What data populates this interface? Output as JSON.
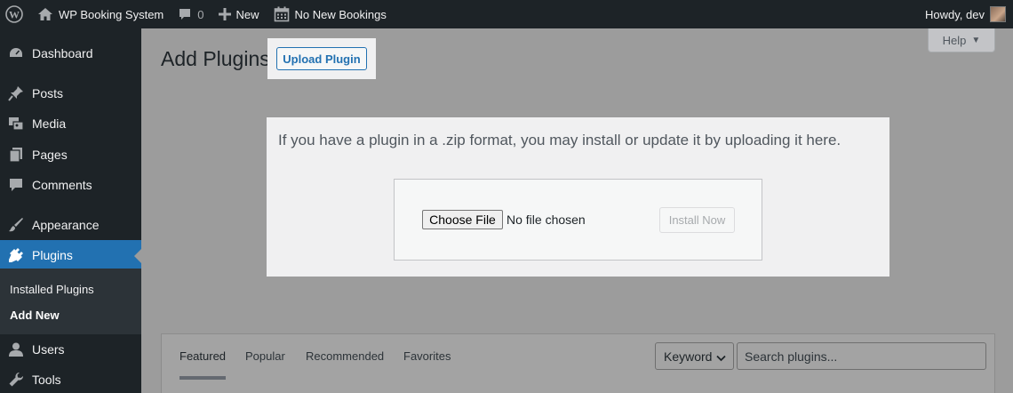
{
  "adminbar": {
    "site_name": "WP Booking System",
    "comments_count": "0",
    "new_label": "New",
    "bookings_label": "No New Bookings",
    "greeting": "Howdy, dev"
  },
  "sidebar": {
    "items": [
      {
        "label": "Dashboard",
        "icon": "dashboard-icon"
      },
      {
        "label": "Posts",
        "icon": "pin-icon"
      },
      {
        "label": "Media",
        "icon": "media-icon"
      },
      {
        "label": "Pages",
        "icon": "pages-icon"
      },
      {
        "label": "Comments",
        "icon": "comment-icon"
      },
      {
        "label": "Appearance",
        "icon": "brush-icon"
      },
      {
        "label": "Plugins",
        "icon": "plug-icon"
      },
      {
        "label": "Users",
        "icon": "user-icon"
      },
      {
        "label": "Tools",
        "icon": "wrench-icon"
      }
    ],
    "submenu": [
      {
        "label": "Installed Plugins"
      },
      {
        "label": "Add New"
      }
    ]
  },
  "header": {
    "title": "Add Plugins",
    "upload_label": "Upload Plugin",
    "help_label": "Help"
  },
  "upload": {
    "help_text": "If you have a plugin in a .zip format, you may install or update it by uploading it here.",
    "choose_label": "Choose File",
    "no_file_text": "No file chosen",
    "install_label": "Install Now"
  },
  "filter": {
    "tabs": [
      {
        "label": "Featured"
      },
      {
        "label": "Popular"
      },
      {
        "label": "Recommended"
      },
      {
        "label": "Favorites"
      }
    ],
    "search_type": "Keyword",
    "search_placeholder": "Search plugins..."
  },
  "colors": {
    "admin_bg": "#1d2327",
    "accent": "#2271b1",
    "overlay": "#9c9c9c"
  }
}
